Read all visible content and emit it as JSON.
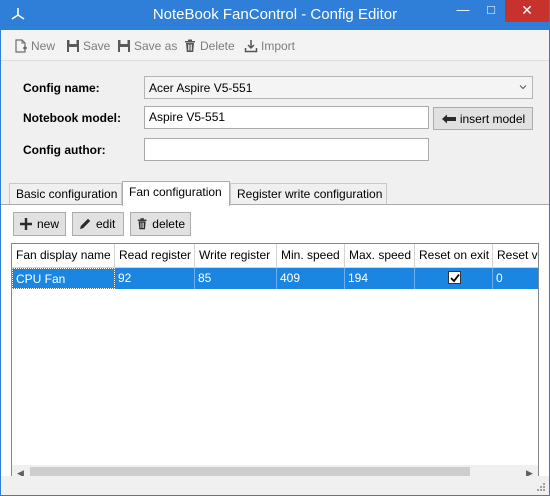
{
  "window": {
    "title": "NoteBook FanControl - Config Editor"
  },
  "toolbar": {
    "new_label": "New",
    "save_label": "Save",
    "saveas_label": "Save as",
    "delete_label": "Delete",
    "import_label": "Import"
  },
  "form": {
    "config_name_label": "Config name:",
    "config_name_value": "Acer Aspire V5-551",
    "notebook_model_label": "Notebook model:",
    "notebook_model_value": "Aspire V5-551",
    "insert_model_label": "insert model",
    "config_author_label": "Config author:",
    "config_author_value": ""
  },
  "tabs": [
    {
      "label": "Basic configuration",
      "active": false
    },
    {
      "label": "Fan configuration",
      "active": true
    },
    {
      "label": "Register write configuration",
      "active": false
    }
  ],
  "panel": {
    "new_label": "new",
    "edit_label": "edit",
    "delete_label": "delete"
  },
  "grid": {
    "columns": [
      "Fan display name",
      "Read register",
      "Write register",
      "Min. speed",
      "Max. speed",
      "Reset on exit",
      "Reset va"
    ],
    "rows": [
      {
        "fan_display_name": "CPU Fan",
        "read_register": "92",
        "write_register": "85",
        "min_speed": "409",
        "max_speed": "194",
        "reset_on_exit": true,
        "reset_value": "0"
      }
    ]
  },
  "colors": {
    "accent": "#2f7ed8",
    "selection": "#1b86e2",
    "close_button": "#c7312e"
  },
  "icons": {
    "app": "fan-icon",
    "new": "new-document-icon",
    "save": "floppy-icon",
    "saveas": "floppy-icon",
    "delete": "trash-icon",
    "import": "import-icon",
    "insert_model": "arrow-left-icon",
    "panel_new": "plus-icon",
    "panel_edit": "pencil-icon",
    "panel_delete": "trash-icon"
  }
}
